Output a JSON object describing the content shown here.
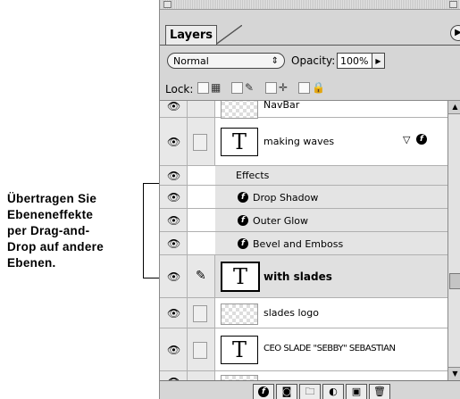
{
  "callout": {
    "lines": [
      "Übertragen Sie",
      "Ebeneneffekte",
      "per Drag-and-",
      "Drop auf andere",
      "Ebenen."
    ]
  },
  "palette": {
    "tab": "Layers",
    "blend_mode": "Normal",
    "opacity_label": "Opacity:",
    "opacity_value": "100%",
    "lock_label": "Lock:"
  },
  "layers": {
    "navbar": "NavBar",
    "making_waves": "making waves",
    "effects": "Effects",
    "drop_shadow": "Drop Shadow",
    "outer_glow": "Outer Glow",
    "bevel_emboss": "Bevel and Emboss",
    "with_slades": "with slades",
    "slades_logo": "slades logo",
    "ceo": "CEO SLADE \"SEBBY\" SEBASTIAN"
  },
  "icons": {
    "eye": "eye-icon",
    "brush": "brush-icon",
    "fx": "layer-effects-icon",
    "trash": "trash-icon"
  }
}
